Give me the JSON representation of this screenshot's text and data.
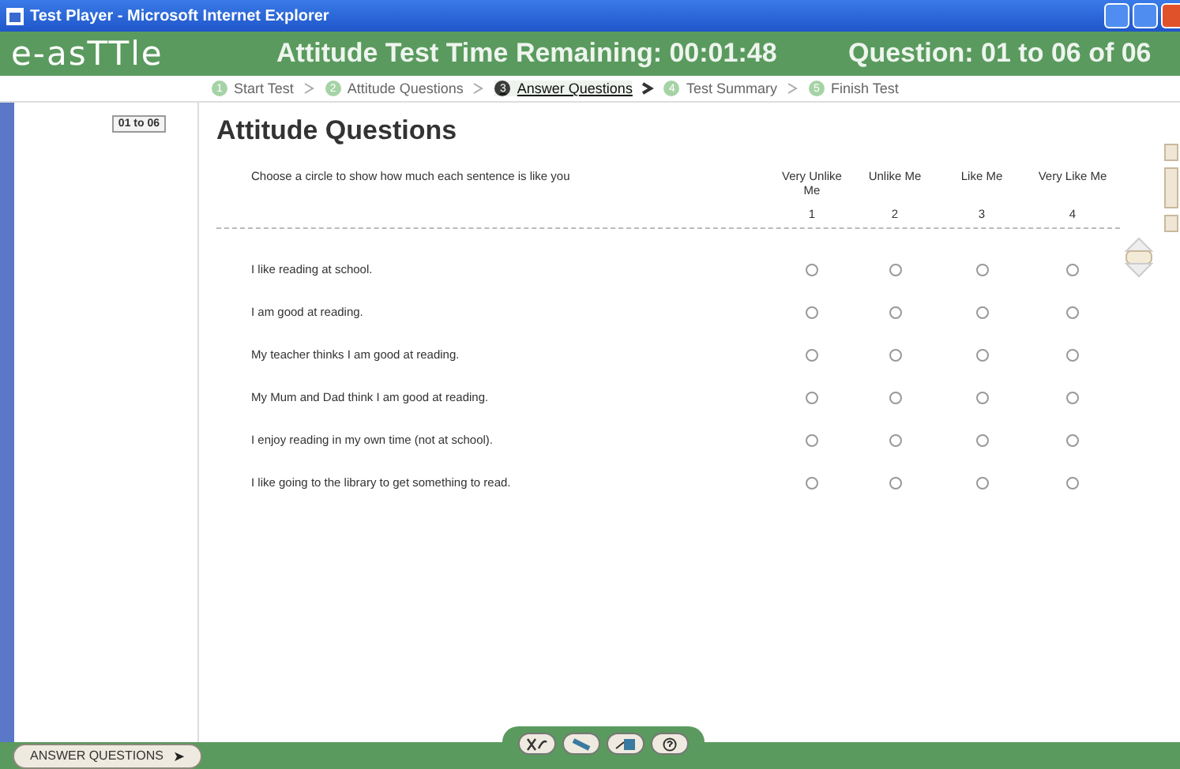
{
  "window": {
    "title": "Test Player - Microsoft Internet Explorer"
  },
  "header": {
    "logo": "e-asTTle",
    "timer": "Attitude Test Time Remaining: 00:01:48",
    "question": "Question: 01 to 06 of 06"
  },
  "steps": [
    {
      "number": "1",
      "label": "Start Test",
      "selected": false
    },
    {
      "number": "2",
      "label": "Attitude Questions",
      "selected": false
    },
    {
      "number": "3",
      "label": "Answer Questions",
      "selected": true
    },
    {
      "number": "4",
      "label": "Test Summary",
      "selected": false
    },
    {
      "number": "5",
      "label": "Finish Test",
      "selected": false
    }
  ],
  "sidebar": {
    "badge": "01 to 06"
  },
  "section": {
    "title": "Attitude Questions",
    "instruction": "Choose a circle to show how much each sentence is like you",
    "columns": [
      {
        "label": "Very Unlike Me",
        "number": "1"
      },
      {
        "label": "Unlike Me",
        "number": "2"
      },
      {
        "label": "Like Me",
        "number": "3"
      },
      {
        "label": "Very Like Me",
        "number": "4"
      }
    ],
    "rows": [
      {
        "text": "I like reading at school.",
        "options": [
          {
            "selected": false
          },
          {
            "selected": false
          },
          {
            "selected": false
          },
          {
            "selected": false
          }
        ]
      },
      {
        "text": "I am good at reading.",
        "options": [
          {
            "selected": false
          },
          {
            "selected": false
          },
          {
            "selected": false
          },
          {
            "selected": false
          }
        ]
      },
      {
        "text": "My teacher thinks I am good at reading.",
        "options": [
          {
            "selected": false
          },
          {
            "selected": false
          },
          {
            "selected": false
          },
          {
            "selected": false
          }
        ]
      },
      {
        "text": "My Mum and Dad think I am good at reading.",
        "options": [
          {
            "selected": false
          },
          {
            "selected": false
          },
          {
            "selected": false
          },
          {
            "selected": false
          }
        ]
      },
      {
        "text": "I enjoy reading in my own time (not at school).",
        "options": [
          {
            "selected": false
          },
          {
            "selected": false
          },
          {
            "selected": false
          },
          {
            "selected": false
          }
        ]
      },
      {
        "text": "I like going to the library to get something to read.",
        "options": [
          {
            "selected": false
          },
          {
            "selected": false
          },
          {
            "selected": false
          },
          {
            "selected": false
          }
        ]
      }
    ]
  },
  "footer": {
    "button": "ANSWER QUESTIONS",
    "arrow": "➤"
  }
}
